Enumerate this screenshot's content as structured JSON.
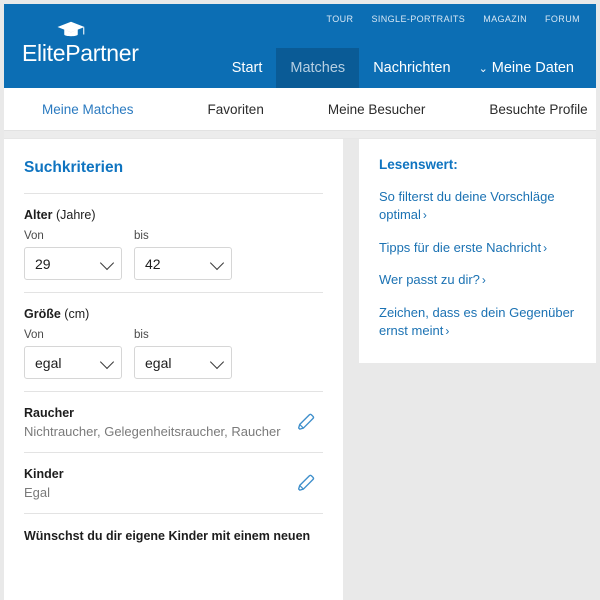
{
  "brand": {
    "name": "ElitePartner",
    "cap_icon": "graduation-cap-icon"
  },
  "utility_nav": [
    {
      "label": "TOUR"
    },
    {
      "label": "SINGLE-PORTRAITS"
    },
    {
      "label": "MAGAZIN"
    },
    {
      "label": "FORUM"
    }
  ],
  "main_nav": [
    {
      "label": "Start",
      "active": false
    },
    {
      "label": "Matches",
      "active": true
    },
    {
      "label": "Nachrichten",
      "active": false
    },
    {
      "label": "Meine Daten",
      "active": false,
      "chevron": "⌄"
    }
  ],
  "tabs": [
    {
      "label": "Meine Matches",
      "active": true
    },
    {
      "label": "Favoriten",
      "active": false
    },
    {
      "label": "Meine Besucher",
      "active": false
    },
    {
      "label": "Besuchte Profile",
      "active": false
    }
  ],
  "search_panel": {
    "title": "Suchkriterien",
    "age": {
      "label_bold": "Alter",
      "label_unit": " (Jahre)",
      "from_label": "Von",
      "to_label": "bis",
      "from_value": "29",
      "to_value": "42"
    },
    "height": {
      "label_bold": "Größe",
      "label_unit": " (cm)",
      "from_label": "Von",
      "to_label": "bis",
      "from_value": "egal",
      "to_value": "egal"
    },
    "smoker": {
      "title": "Raucher",
      "value": "Nichtraucher, Gelegenheitsraucher, Raucher",
      "edit_icon": "pencil-icon"
    },
    "children": {
      "title": "Kinder",
      "value": "Egal",
      "edit_icon": "pencil-icon"
    },
    "own_children_question": "Wünschst du dir eigene Kinder mit einem neuen"
  },
  "sidebar": {
    "title": "Lesenswert:",
    "links": [
      {
        "label": "So filterst du deine Vorschläge optimal",
        "arrow": "›"
      },
      {
        "label": "Tipps für die erste Nachricht",
        "arrow": "›"
      },
      {
        "label": "Wer passt zu dir?",
        "arrow": "›"
      },
      {
        "label": "Zeichen, dass es dein Gegenüber ernst meint",
        "arrow": "›"
      }
    ]
  },
  "colors": {
    "header_blue": "#0c6eb4",
    "active_nav_blue": "#0a5b96",
    "link_blue": "#1b72b3",
    "heading_blue": "#0f74c0",
    "page_gray": "#e9e9e9"
  }
}
